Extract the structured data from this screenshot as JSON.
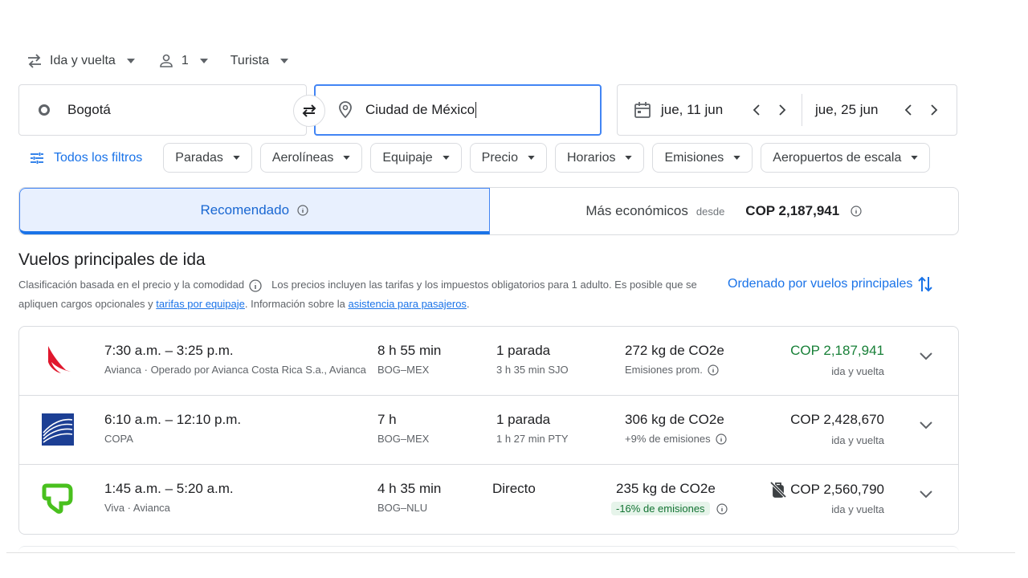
{
  "trip_options": {
    "trip_type": "Ida y vuelta",
    "passengers": "1",
    "cabin": "Turista"
  },
  "search": {
    "origin": "Bogotá",
    "destination": "Ciudad de México",
    "depart_date": "jue, 11 jun",
    "return_date": "jue, 25 jun"
  },
  "filters": {
    "all_filters": "Todos los filtros",
    "chips": [
      "Paradas",
      "Aerolíneas",
      "Equipaje",
      "Precio",
      "Horarios",
      "Emisiones",
      "Aeropuertos de escala"
    ]
  },
  "tabs": {
    "recommended": "Recomendado",
    "cheapest": "Más económicos",
    "cheapest_from": "desde",
    "cheapest_price": "COP 2,187,941"
  },
  "results": {
    "title": "Vuelos principales de ida",
    "note_part1": "Clasificación basada en el precio y la comodidad",
    "note_part2": "Los precios incluyen las tarifas y los impuestos obligatorios para 1 adulto. Es posible que se apliquen cargos opcionales y",
    "note_link1": "tarifas por equipaje",
    "note_part3": ". Información sobre la",
    "note_link2": "asistencia para pasajeros",
    "note_part4": ".",
    "sort_label": "Ordenado por vuelos principales"
  },
  "flights": [
    {
      "times": "7:30 a.m. – 3:25 p.m.",
      "airline": "Avianca · Operado por Avianca Costa Rica S.a., Avianca",
      "duration": "8 h 55 min",
      "route": "BOG–MEX",
      "stops": "1 parada",
      "stop_info": "3 h 35 min SJO",
      "co2": "272 kg de CO2e",
      "co2_note": "Emisiones prom.",
      "price": "COP 2,187,941",
      "price_note": "ida y vuelta",
      "logo": "avianca-logo",
      "price_color": "#188038"
    },
    {
      "times": "6:10 a.m. – 12:10 p.m.",
      "airline": "COPA",
      "duration": "7 h",
      "route": "BOG–MEX",
      "stops": "1 parada",
      "stop_info": "1 h 27 min PTY",
      "co2": "306 kg de CO2e",
      "co2_note": "+9% de emisiones",
      "price": "COP 2,428,670",
      "price_note": "ida y vuelta",
      "logo": "copa-logo",
      "price_color": "#202124"
    },
    {
      "times": "1:45 a.m. – 5:20 a.m.",
      "airline": "Viva · Avianca",
      "duration": "4 h 35 min",
      "route": "BOG–NLU",
      "stops": "Directo",
      "stop_info": "",
      "co2": "235 kg de CO2e",
      "co2_note": "-16% de emisiones",
      "price": "COP 2,560,790",
      "price_note": "ida y vuelta",
      "logo": "viva-logo",
      "price_color": "#202124",
      "no_bag_icon": "no-carry-on-icon"
    }
  ],
  "colors": {
    "accent": "#1a73e8",
    "green_price": "#188038",
    "green_badge": "#e6f4ea"
  }
}
